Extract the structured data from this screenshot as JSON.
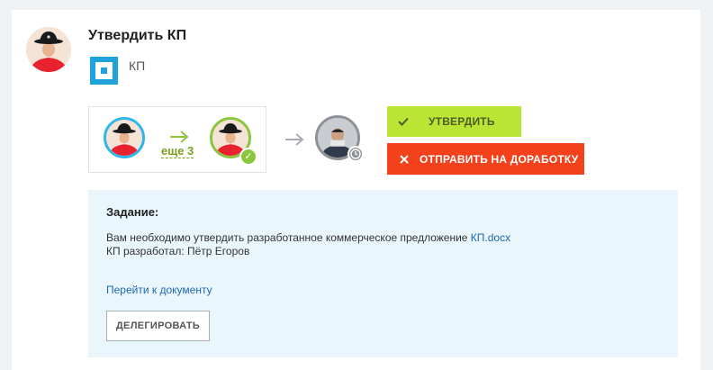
{
  "header": {
    "title": "Утвердить КП"
  },
  "attachment": {
    "name": "КП",
    "icon": "document-icon"
  },
  "workflow": {
    "more_label": "еще 3",
    "icons": {
      "arrow_green": "arrow-right-icon",
      "arrow_gray": "arrow-right-icon",
      "check": "check-icon",
      "clock": "clock-icon"
    }
  },
  "actions": {
    "approve_label": "УТВЕРДИТЬ",
    "reject_label": "ОТПРАВИТЬ НА ДОРАБОТКУ",
    "approve_color": "#bbe534",
    "reject_color": "#f2411b"
  },
  "task": {
    "heading": "Задание:",
    "line1_text": "Вам необходимо утвердить разработанное коммерческое предложение ",
    "line1_link": "КП.docx",
    "line2_text": "КП разработал: Пётр Егоров",
    "goto_link": "Перейти к документу",
    "delegate_label": "ДЕЛЕГИРОВАТЬ",
    "background": "#e9f7fd"
  }
}
